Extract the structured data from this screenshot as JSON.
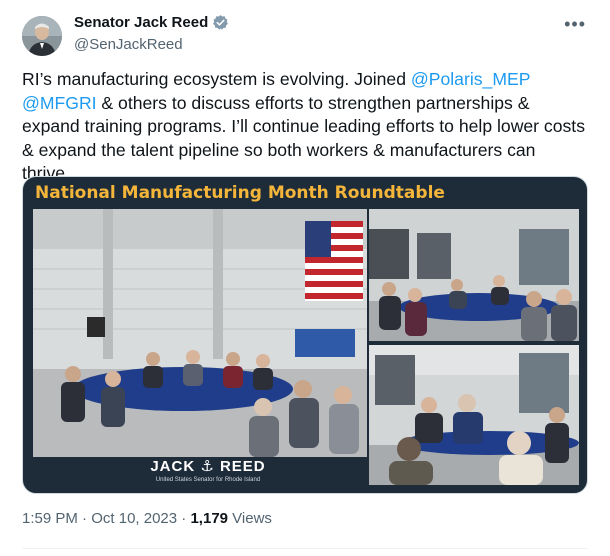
{
  "author": {
    "name": "Senator Jack Reed",
    "handle": "@SenJackReed"
  },
  "menu": {
    "more_label": "•••"
  },
  "tweet": {
    "text_1": "RI’s manufacturing ecosystem is evolving. Joined ",
    "mention_1": "@Polaris_MEP",
    "text_2": " ",
    "mention_2": "@MFGRI",
    "text_3": " & others to discuss efforts to strengthen partnerships & expand training programs. I’ll continue leading efforts to help lower costs & expand the talent pipeline so both workers & manufacturers can thrive."
  },
  "media": {
    "banner_title": "National Manufacturing Month Roundtable",
    "brand_name": "JACK ⚓ REED",
    "brand_subtitle": "United States Senator for Rhode Island"
  },
  "meta": {
    "time": "1:59 PM",
    "separator": " · ",
    "date": "Oct 10, 2023",
    "separator2": " · ",
    "views_count": "1,179",
    "views_label": " Views"
  },
  "colors": {
    "accent": "#1d9bf0",
    "banner_bg": "#1e2c3a",
    "banner_title": "#f3b53a"
  }
}
